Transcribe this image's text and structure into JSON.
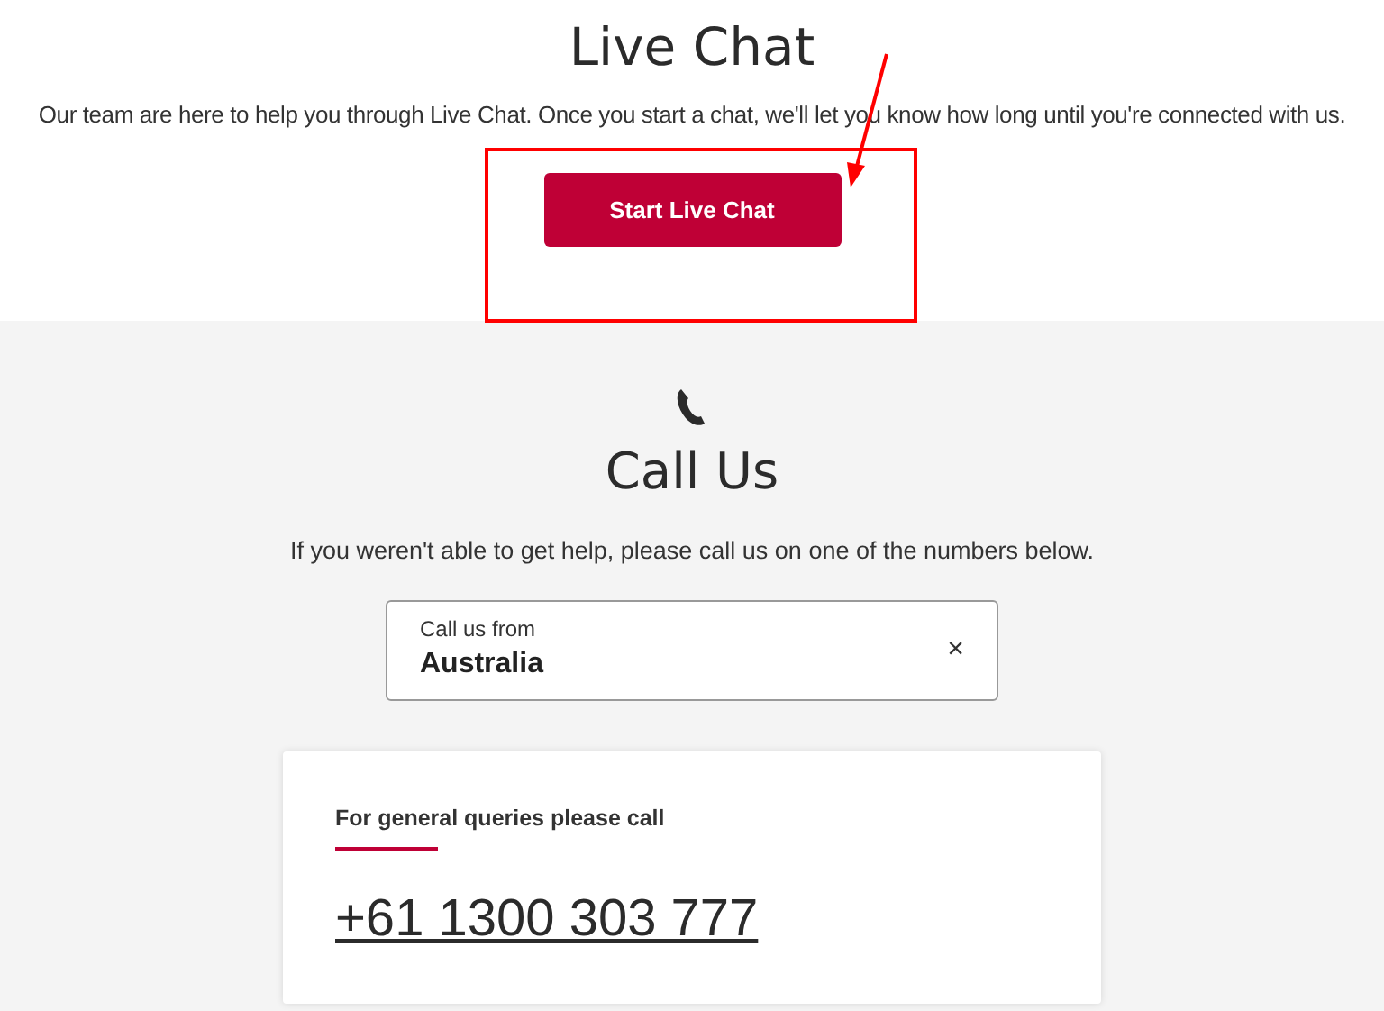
{
  "live_chat": {
    "title": "Live Chat",
    "description": "Our team are here to help you through Live Chat. Once you start a chat, we'll let you know how long until you're connected with us.",
    "button": "Start Live Chat"
  },
  "call_us": {
    "title": "Call Us",
    "description": "If you weren't able to get help, please call us on one of the numbers below.",
    "country_field": {
      "label": "Call us from",
      "value": "Australia",
      "clear": "×"
    },
    "card": {
      "heading": "For general queries please call",
      "phone": "+61 1300 303 777"
    }
  }
}
